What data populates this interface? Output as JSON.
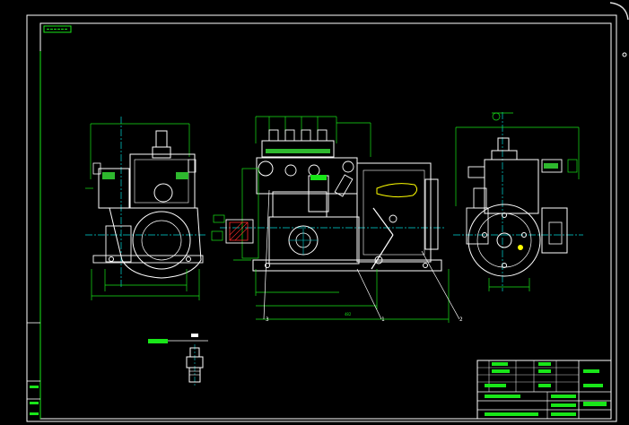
{
  "drawing": {
    "background": "#000000",
    "colors": {
      "frame": "#ffffff",
      "outline": "#ffffff",
      "dimension": "#19e619",
      "centerline": "#00d7d7",
      "hatch": "#ff2a2a",
      "highlight": "#ffff00",
      "fill_green": "#2eb82e"
    },
    "corner_tag": "",
    "part_callouts": [
      "3",
      "1",
      "2"
    ],
    "overall_dimension": "482"
  }
}
